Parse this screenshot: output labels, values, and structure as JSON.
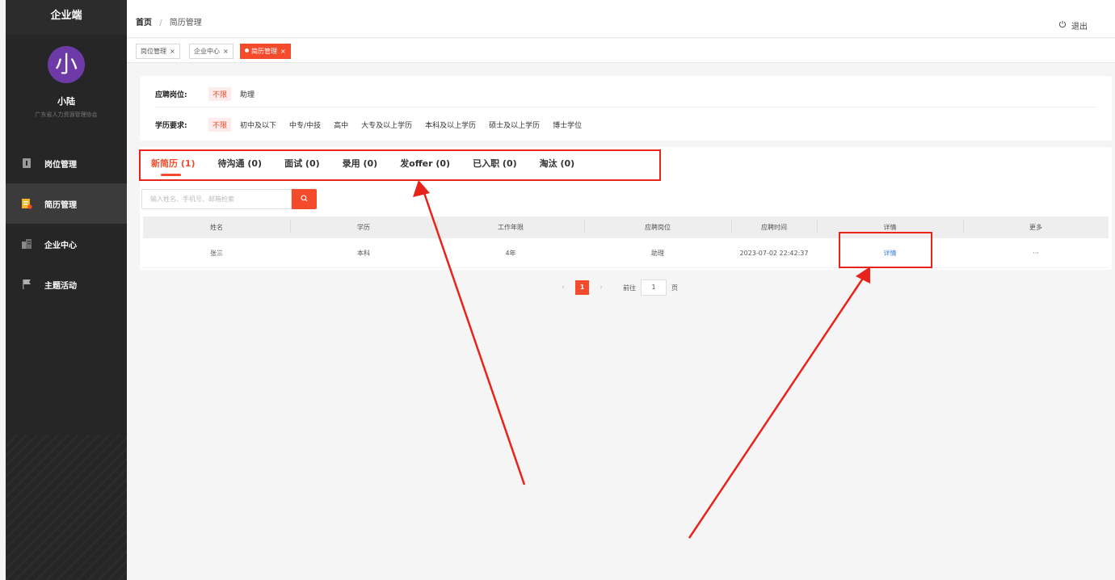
{
  "sidebar": {
    "brand": "企业端",
    "avatar_char": "小",
    "user_name": "小陆",
    "org": "广东省人力资源管理协会",
    "items": [
      {
        "label": "岗位管理",
        "icon": "job-icon"
      },
      {
        "label": "简历管理",
        "icon": "resume-icon"
      },
      {
        "label": "企业中心",
        "icon": "building-icon"
      },
      {
        "label": "主题活动",
        "icon": "flag-icon"
      }
    ],
    "active_index": 1
  },
  "header": {
    "breadcrumb_home": "首页",
    "breadcrumb_sep": "/",
    "breadcrumb_current": "简历管理",
    "logout_label": "退出"
  },
  "tags": [
    {
      "label": "岗位管理"
    },
    {
      "label": "企业中心"
    },
    {
      "label": "简历管理",
      "active": true
    }
  ],
  "filters": {
    "position": {
      "label": "应聘岗位:",
      "options": [
        "不限",
        "助理"
      ],
      "selected": 0
    },
    "education": {
      "label": "学历要求:",
      "options": [
        "不限",
        "初中及以下",
        "中专/中技",
        "高中",
        "大专及以上学历",
        "本科及以上学历",
        "硕士及以上学历",
        "博士学位"
      ],
      "selected": 0
    }
  },
  "status_tabs": [
    {
      "label": "新简历 (1)"
    },
    {
      "label": "待沟通 (0)"
    },
    {
      "label": "面试 (0)"
    },
    {
      "label": "录用 (0)"
    },
    {
      "label": "发offer (0)"
    },
    {
      "label": "已入职 (0)"
    },
    {
      "label": "淘汰 (0)"
    }
  ],
  "search": {
    "placeholder": "输入姓名、手机号、邮箱检索"
  },
  "table": {
    "columns": [
      "姓名",
      "学历",
      "工作年限",
      "应聘岗位",
      "应聘时间",
      "详情",
      "更多"
    ],
    "rows": [
      {
        "name": "张三",
        "education": "本科",
        "years": "4年",
        "position": "助理",
        "time": "2023-07-02 22:42:37",
        "detail": "详情",
        "more": "···"
      }
    ]
  },
  "pagination": {
    "prev": "‹",
    "current": "1",
    "next": "›",
    "goto_label": "前往",
    "goto_value": "1",
    "page_suffix": "页"
  },
  "colors": {
    "accent": "#f34b2c",
    "sidebar_bg": "#262626",
    "annotation": "#e8231a",
    "link": "#3a7bd5"
  }
}
